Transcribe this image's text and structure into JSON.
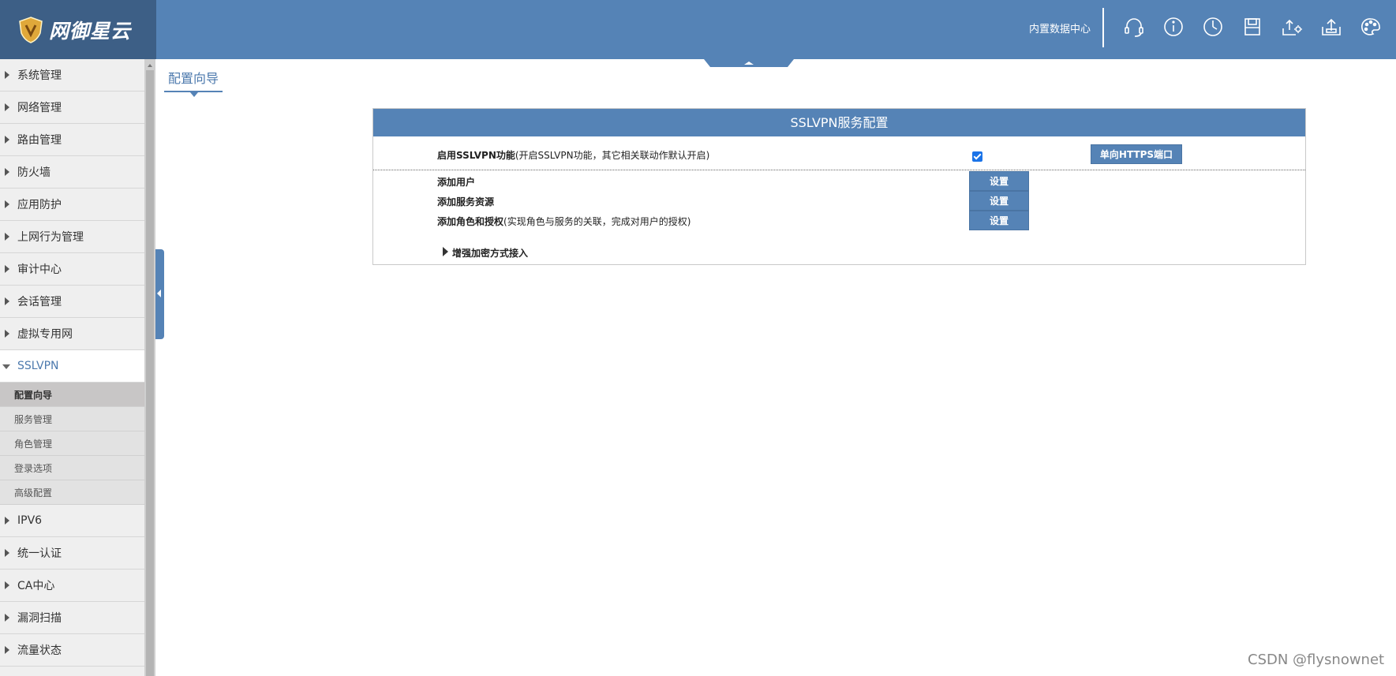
{
  "header": {
    "brand": "网御星云",
    "center_label": "内置数据中心",
    "icons": [
      "headset-icon",
      "info-icon",
      "clock-icon",
      "save-icon",
      "upload-settings-icon",
      "upload-icon",
      "palette-icon"
    ]
  },
  "sidebar": {
    "items_before": [
      {
        "label": "系统管理"
      },
      {
        "label": "网络管理"
      },
      {
        "label": "路由管理"
      },
      {
        "label": "防火墙"
      },
      {
        "label": "应用防护"
      },
      {
        "label": "上网行为管理"
      },
      {
        "label": "审计中心"
      },
      {
        "label": "会话管理"
      },
      {
        "label": "虚拟专用网"
      }
    ],
    "open_item": {
      "label": "SSLVPN"
    },
    "sub_items": [
      {
        "label": "配置向导"
      },
      {
        "label": "服务管理"
      },
      {
        "label": "角色管理"
      },
      {
        "label": "登录选项"
      },
      {
        "label": "高级配置"
      }
    ],
    "items_after": [
      {
        "label": "IPV6"
      },
      {
        "label": "统一认证"
      },
      {
        "label": "CA中心"
      },
      {
        "label": "漏洞扫描"
      },
      {
        "label": "流量状态"
      }
    ]
  },
  "page_tab": "配置向导",
  "panel": {
    "title": "SSLVPN服务配置",
    "enable": {
      "label_bold": "启用SSLVPN功能",
      "label_note": "(开启SSLVPN功能，其它相关联动作默认开启)",
      "checked": true,
      "https_button": "单向HTTPS端口"
    },
    "rows": [
      {
        "label_bold": "添加用户",
        "label_note": "",
        "button": "设置"
      },
      {
        "label_bold": "添加服务资源",
        "label_note": "",
        "button": "设置"
      },
      {
        "label_bold": "添加角色和授权",
        "label_note": "(实现角色与服务的关联，完成对用户的授权)",
        "button": "设置"
      }
    ],
    "expander": "增强加密方式接入"
  },
  "watermark": "CSDN @flysnownet",
  "colors": {
    "header": "#5583b6",
    "logo_bg": "#3d5f86",
    "accent": "#4c79ad"
  }
}
